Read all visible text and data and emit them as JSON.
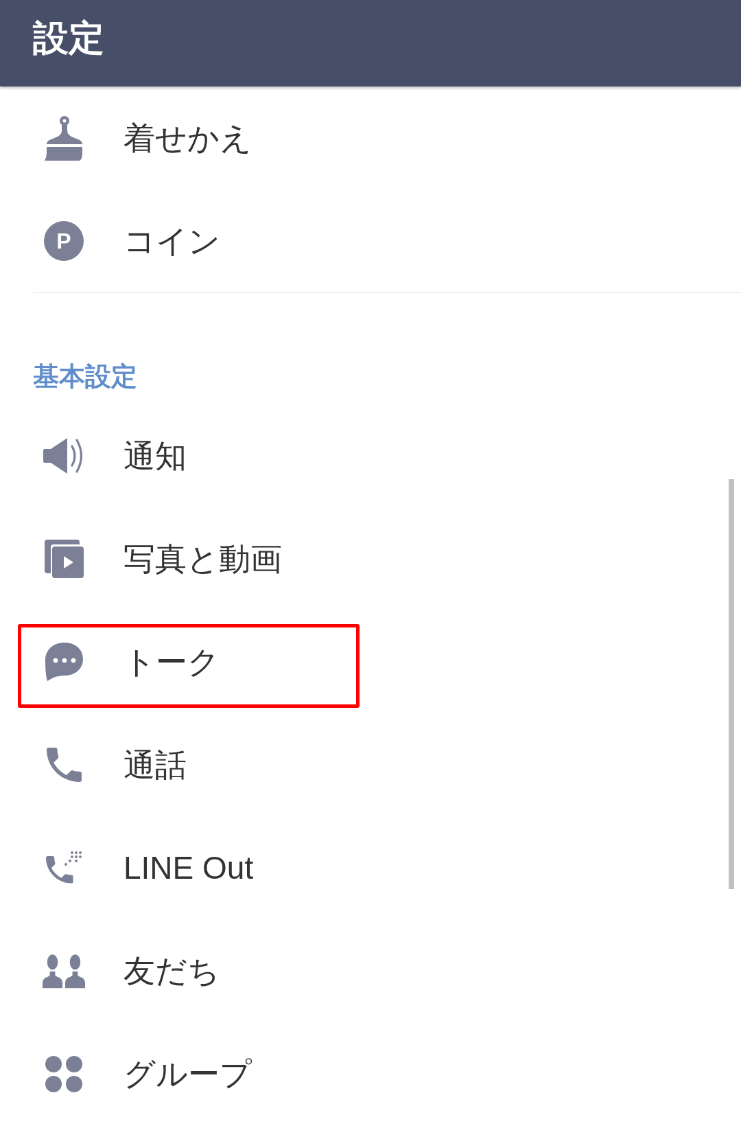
{
  "header": {
    "title": "設定"
  },
  "items": [
    {
      "label": "着せかえ",
      "highlighted": false
    },
    {
      "label": "コイン",
      "icon_letter": "P",
      "highlighted": false
    }
  ],
  "sections": [
    {
      "title": "基本設定",
      "items": [
        {
          "label": "通知",
          "highlighted": false
        },
        {
          "label": "写真と動画",
          "highlighted": false
        },
        {
          "label": "トーク",
          "highlighted": true
        },
        {
          "label": "通話",
          "highlighted": false
        },
        {
          "label": "LINE Out",
          "highlighted": false
        },
        {
          "label": "友だち",
          "highlighted": false
        },
        {
          "label": "グループ",
          "highlighted": false
        }
      ]
    }
  ]
}
